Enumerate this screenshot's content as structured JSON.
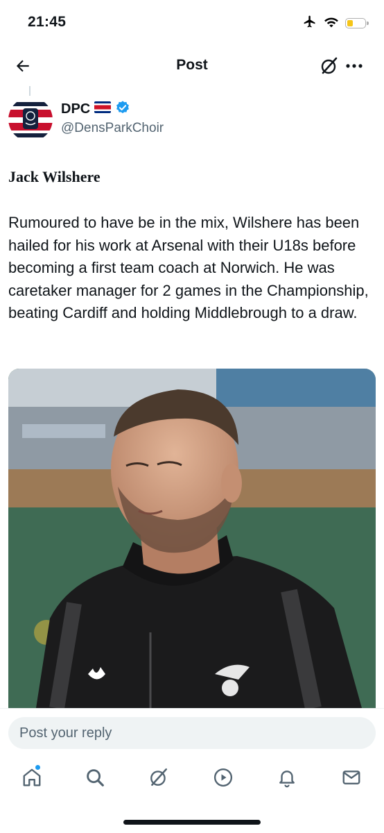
{
  "status_bar": {
    "time": "21:45",
    "icons": [
      "airplane-icon",
      "wifi-icon",
      "battery-icon"
    ],
    "battery_level": 0.35,
    "battery_color": "#f5c518"
  },
  "nav": {
    "title": "Post",
    "back_icon": "arrow-left-icon",
    "grok_icon": "grok-icon",
    "more_icon": "more-icon"
  },
  "post": {
    "author": {
      "name": "DPC",
      "flag": "costa-rica-flag",
      "verified": true,
      "handle": "@DensParkChoir"
    },
    "heading": "Jack Wilshere",
    "body": "Rumoured to have be in the mix, Wilshere has been hailed for his work at Arsenal with their U18s before becoming a first team coach at Norwich. He was caretaker manager for 2 games in the Championship, beating Cardiff and holding Middlebrough to a draw.",
    "media": {
      "type": "photo"
    }
  },
  "reply": {
    "placeholder": "Post your reply"
  },
  "tab_bar": {
    "items": [
      "home-icon",
      "search-icon",
      "grok-icon",
      "video-icon",
      "notifications-icon",
      "messages-icon"
    ],
    "home_badge": true
  },
  "colors": {
    "accent": "#1d9bf0",
    "text": "#0f1419",
    "secondary_text": "#536471",
    "input_background": "#eff3f4"
  }
}
